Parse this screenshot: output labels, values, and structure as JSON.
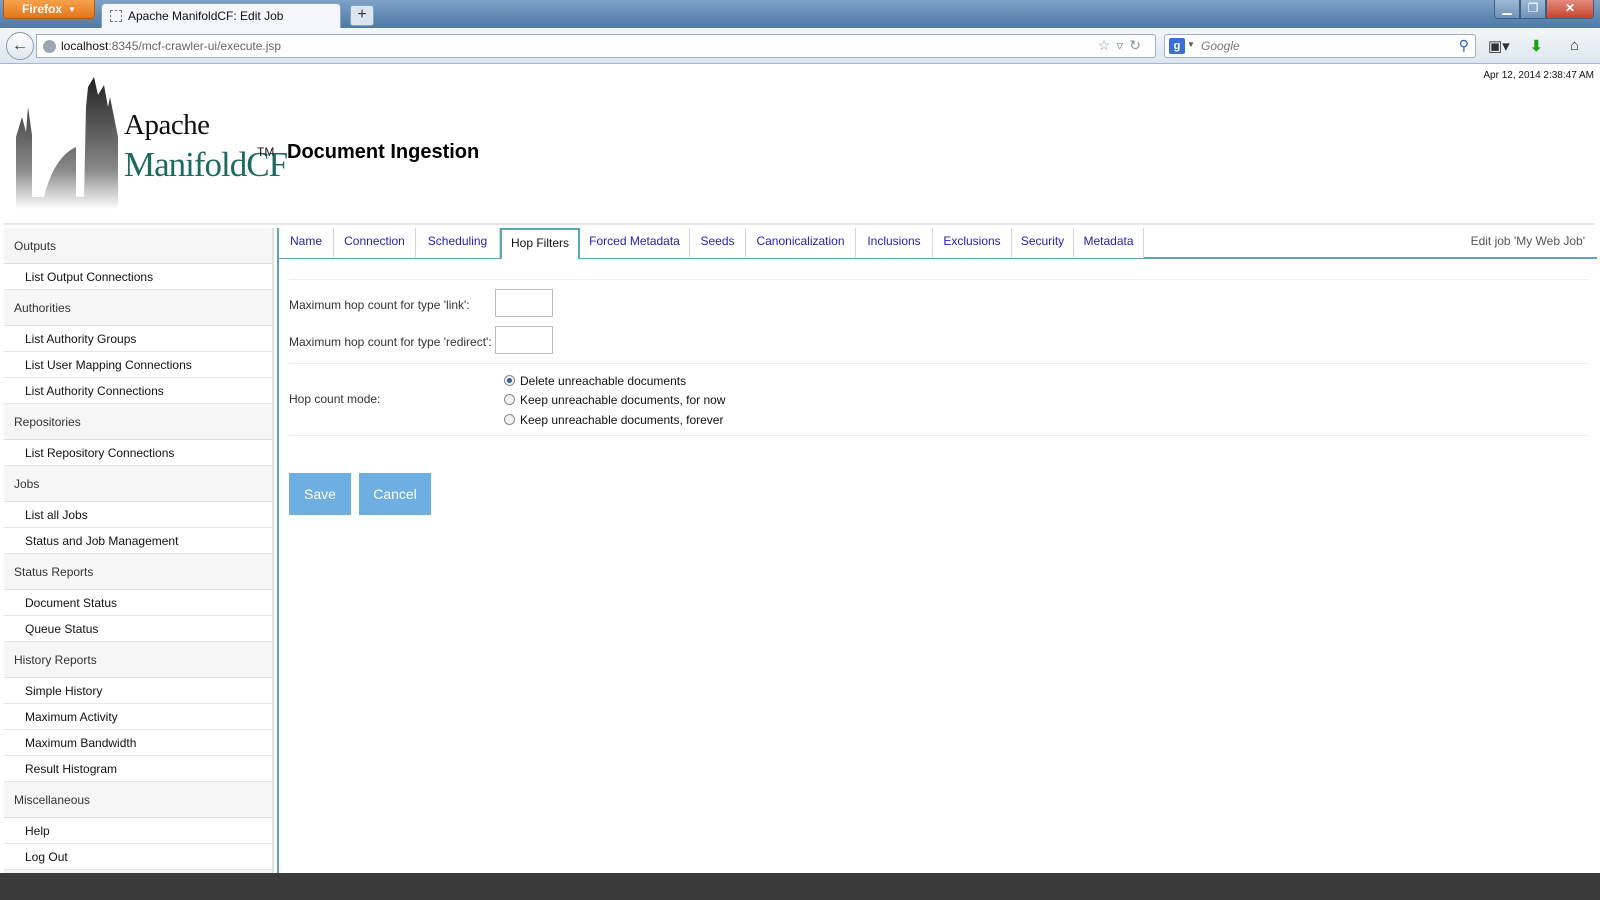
{
  "browser": {
    "app_button": "Firefox",
    "tab_title": "Apache ManifoldCF: Edit Job",
    "url_host": "localhost",
    "url_path": ":8345/mcf-crawler-ui/execute.jsp",
    "search_placeholder": "Google",
    "new_tab": "+"
  },
  "header": {
    "timestamp": "Apr 12, 2014 2:38:47 AM",
    "logo_line1": "Apache",
    "logo_line2": "ManifoldCF",
    "logo_tm": "TM",
    "title": "Document Ingestion"
  },
  "sidebar": {
    "sections": [
      {
        "title": "Outputs",
        "items": [
          "List Output Connections"
        ]
      },
      {
        "title": "Authorities",
        "items": [
          "List Authority Groups",
          "List User Mapping Connections",
          "List Authority Connections"
        ]
      },
      {
        "title": "Repositories",
        "items": [
          "List Repository Connections"
        ]
      },
      {
        "title": "Jobs",
        "items": [
          "List all Jobs",
          "Status and Job Management"
        ]
      },
      {
        "title": "Status Reports",
        "items": [
          "Document Status",
          "Queue Status"
        ]
      },
      {
        "title": "History Reports",
        "items": [
          "Simple History",
          "Maximum Activity",
          "Maximum Bandwidth",
          "Result Histogram"
        ]
      },
      {
        "title": "Miscellaneous",
        "items": [
          "Help",
          "Log Out"
        ]
      }
    ]
  },
  "tabs": [
    "Name",
    "Connection",
    "Scheduling",
    "Hop Filters",
    "Forced Metadata",
    "Seeds",
    "Canonicalization",
    "Inclusions",
    "Exclusions",
    "Security",
    "Metadata"
  ],
  "active_tab": "Hop Filters",
  "edit_label": "Edit job 'My Web Job'",
  "form": {
    "link_label": "Maximum hop count for type 'link':",
    "link_value": "",
    "redirect_label": "Maximum hop count for type 'redirect':",
    "redirect_value": "",
    "mode_label": "Hop count mode:",
    "mode_options": [
      "Delete unreachable documents",
      "Keep unreachable documents, for now",
      "Keep unreachable documents, forever"
    ],
    "mode_selected": "Delete unreachable documents",
    "save": "Save",
    "cancel": "Cancel"
  },
  "colors": {
    "accent": "#5aa6b3",
    "button": "#6eaee0",
    "link": "#2222bb",
    "logo_green": "#1d6b5f"
  }
}
